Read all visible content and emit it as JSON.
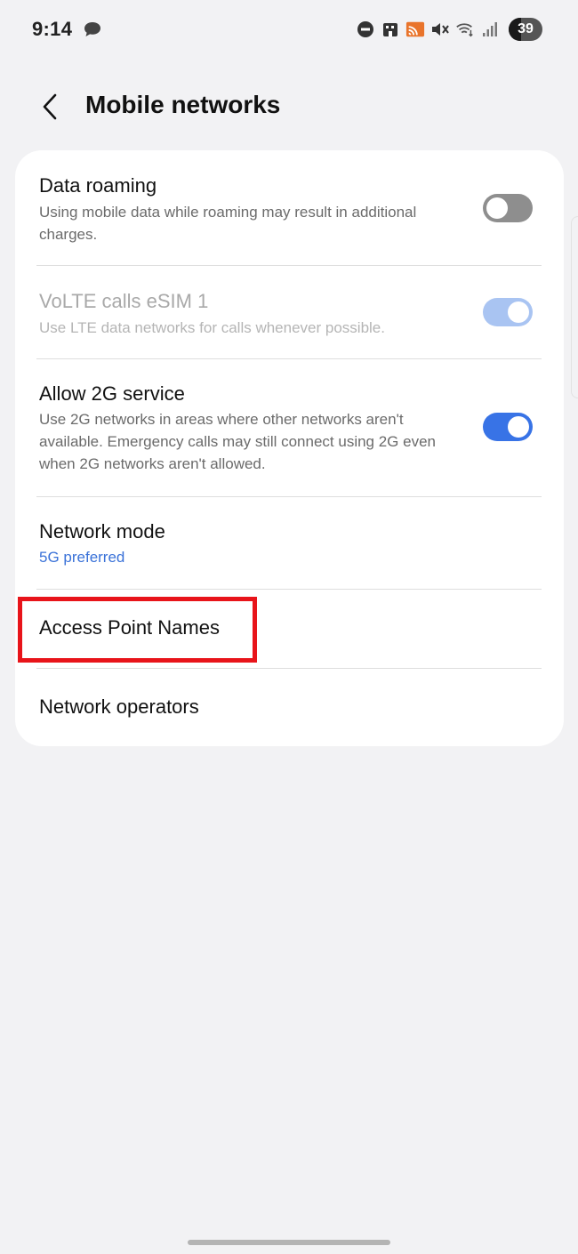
{
  "status_bar": {
    "time": "9:14",
    "battery_level": "39",
    "icons": [
      "chat-bubble-icon",
      "dnd-icon",
      "app-icon",
      "cast-icon",
      "mute-icon",
      "wifi-icon",
      "signal-icon",
      "battery-icon"
    ]
  },
  "header": {
    "title": "Mobile networks"
  },
  "settings": {
    "data_roaming": {
      "title": "Data roaming",
      "description": "Using mobile data while roaming may result in additional charges.",
      "state": "off"
    },
    "volte": {
      "title": "VoLTE calls eSIM 1",
      "description": "Use LTE data networks for calls whenever possible.",
      "state": "on-disabled"
    },
    "allow_2g": {
      "title": "Allow 2G service",
      "description": "Use 2G networks in areas where other networks aren't available. Emergency calls may still connect using 2G even when 2G networks aren't allowed.",
      "state": "on"
    },
    "network_mode": {
      "title": "Network mode",
      "value": "5G preferred"
    },
    "access_point_names": {
      "title": "Access Point Names"
    },
    "network_operators": {
      "title": "Network operators"
    }
  },
  "colors": {
    "accent": "#3873e6",
    "link_blue": "#3a72d8",
    "highlight": "#e8141a",
    "background": "#f2f2f4"
  }
}
